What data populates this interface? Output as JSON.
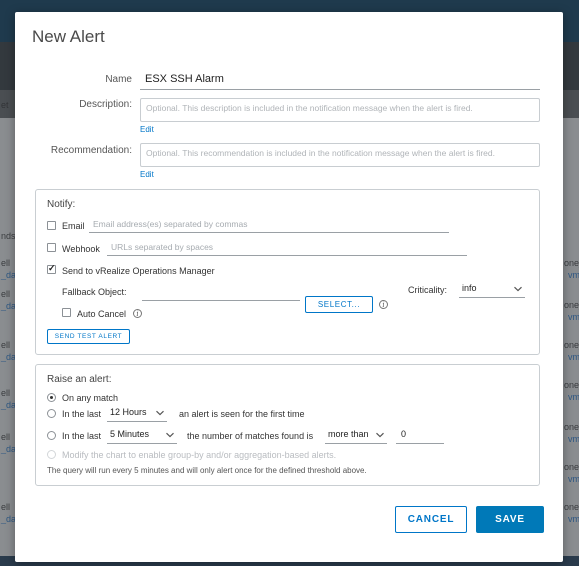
{
  "dialog": {
    "title": "New Alert",
    "name_label": "Name",
    "name_value": "ESX SSH Alarm",
    "description_label": "Description:",
    "description_placeholder": "Optional. This description is included in the notification message when the alert is fired.",
    "recommendation_label": "Recommendation:",
    "recommendation_placeholder": "Optional. This recommendation is included in the notification message when the alert is fired.",
    "edit_label": "Edit"
  },
  "notify": {
    "title": "Notify:",
    "email_label": "Email",
    "email_placeholder": "Email address(es) separated by commas",
    "email_checked": false,
    "webhook_label": "Webhook",
    "webhook_placeholder": "URLs separated by spaces",
    "webhook_checked": false,
    "vrops_label": "Send to vRealize Operations Manager",
    "vrops_checked": true,
    "fallback_label": "Fallback Object:",
    "select_label": "SELECT...",
    "criticality_label": "Criticality:",
    "criticality_value": "info",
    "auto_cancel_label": "Auto Cancel",
    "auto_cancel_checked": false,
    "send_test_label": "SEND TEST ALERT"
  },
  "raise": {
    "title": "Raise an alert:",
    "on_any_match_label": "On any match",
    "selected_option": "On any match",
    "in_the_last_label": "In the last",
    "hours_value": "12 Hours",
    "seen_first_label": "an alert is seen for the first time",
    "minutes_value": "5 Minutes",
    "matches_label": "the number of matches found is",
    "comparison_value": "more than",
    "threshold_value": "0",
    "modify_label": "Modify the chart to enable group-by and/or aggregation-based alerts.",
    "note": "The query will run every 5 minutes and will only alert once for the defined threshold above."
  },
  "buttons": {
    "cancel": "CANCEL",
    "save": "SAVE"
  },
  "background": {
    "left_col": [
      "et",
      "nds",
      "ell",
      "_da",
      "ell",
      "_da",
      "ell",
      "_da",
      "ell",
      "_da",
      "ell",
      "_da",
      "ell",
      "_da"
    ],
    "right_col": [
      "one_",
      "vm",
      "one_",
      "vm",
      "one_",
      "vm",
      "one_",
      "vm",
      "one_",
      "vm",
      "one_",
      "vm",
      "one_",
      "vm"
    ]
  },
  "colors": {
    "accent": "#0079b8",
    "link": "#0076c8",
    "header": "#1f3a4d"
  },
  "icons": [
    "info-icon",
    "chevron-down-icon",
    "checkbox-icon",
    "radio-icon"
  ]
}
